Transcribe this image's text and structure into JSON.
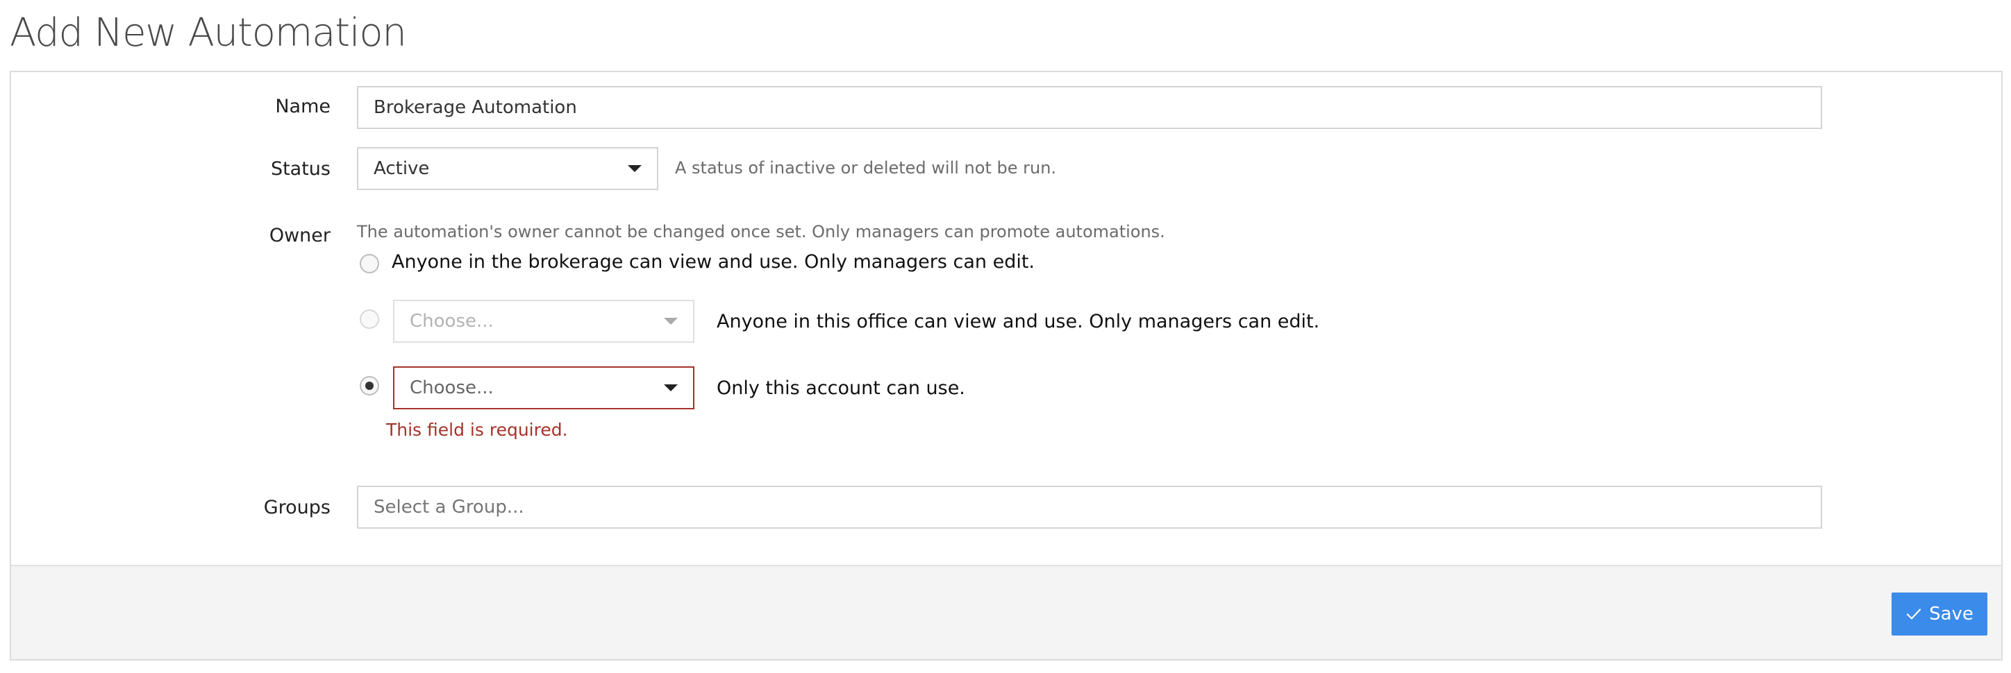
{
  "page": {
    "title": "Add New Automation"
  },
  "form": {
    "name": {
      "label": "Name",
      "value": "Brokerage Automation"
    },
    "status": {
      "label": "Status",
      "selected": "Active",
      "help": "A status of inactive or deleted will not be run."
    },
    "owner": {
      "label": "Owner",
      "help": "The automation's owner cannot be changed once set. Only managers can promote automations.",
      "options": [
        {
          "text": "Anyone in the brokerage can view and use. Only managers can edit.",
          "checked": false
        },
        {
          "text": "Anyone in this office can view and use. Only managers can edit.",
          "select_placeholder": "Choose...",
          "checked": false,
          "disabled": true
        },
        {
          "text": "Only this account can use.",
          "select_placeholder": "Choose...",
          "checked": true
        }
      ],
      "error": "This field is required."
    },
    "groups": {
      "label": "Groups",
      "placeholder": "Select a Group..."
    }
  },
  "footer": {
    "save_label": "Save"
  },
  "colors": {
    "primary": "#3b8bea",
    "error": "#a5322a"
  }
}
